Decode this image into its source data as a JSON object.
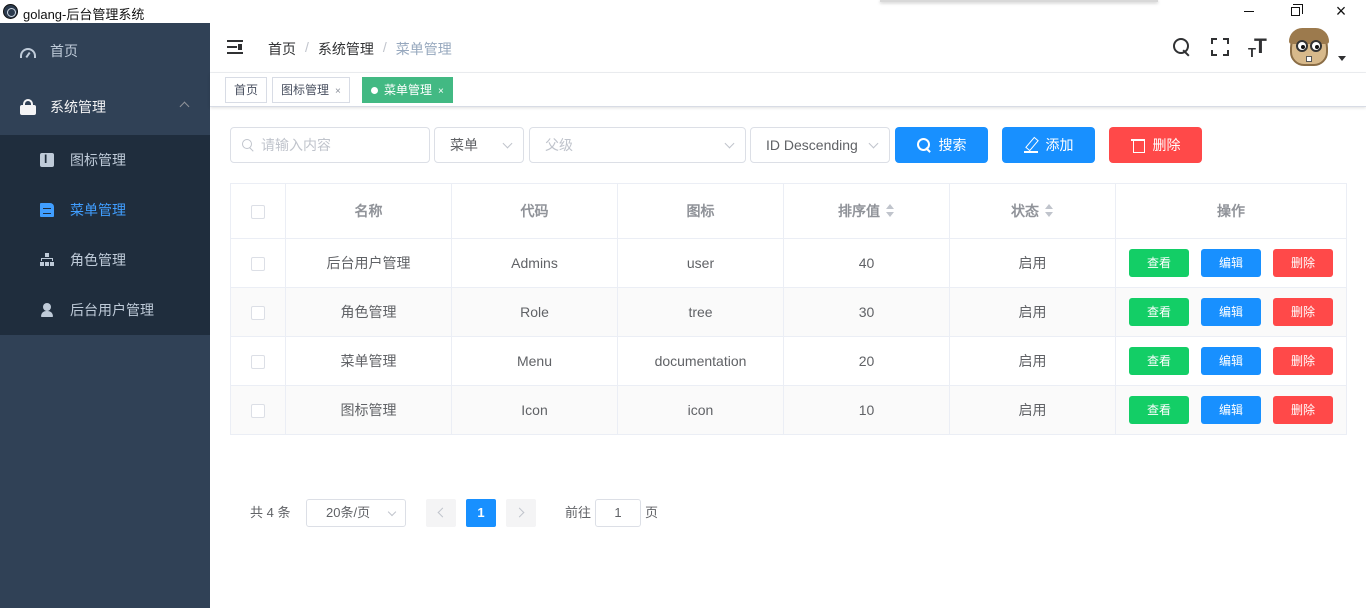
{
  "window": {
    "title": "golang-后台管理系统",
    "minimize": "minimize-icon",
    "maximize": "restore-icon",
    "close": "×"
  },
  "sidebar": {
    "home": "首页",
    "group": "系统管理",
    "items": [
      {
        "label": "图标管理",
        "icon": "icon-icon",
        "active": false
      },
      {
        "label": "菜单管理",
        "icon": "documentation-icon",
        "active": true
      },
      {
        "label": "角色管理",
        "icon": "tree-icon",
        "active": false
      },
      {
        "label": "后台用户管理",
        "icon": "user-icon",
        "active": false
      }
    ],
    "colors": {
      "background": "#304156",
      "submenu_bg": "#1f2d3d",
      "active": "#409eff"
    }
  },
  "navbar": {
    "breadcrumb": [
      "首页",
      "系统管理",
      "菜单管理"
    ],
    "separator": "/",
    "icons": [
      "search-icon",
      "fullscreen-icon",
      "font-size-icon",
      "avatar",
      "caret-down-icon"
    ]
  },
  "tags": [
    {
      "label": "首页",
      "closable": false,
      "active": false
    },
    {
      "label": "图标管理",
      "closable": true,
      "active": false
    },
    {
      "label": "菜单管理",
      "closable": true,
      "active": true
    }
  ],
  "tag_close": "×",
  "filters": {
    "search_placeholder": "请输入内容",
    "type_value": "菜单",
    "parent_placeholder": "父级",
    "sort_value": "ID Descending",
    "search_button": "搜索",
    "add_button": "添加",
    "delete_button": "删除"
  },
  "table": {
    "columns": [
      "名称",
      "代码",
      "图标",
      "排序值",
      "状态",
      "操作"
    ],
    "rows": [
      {
        "name": "后台用户管理",
        "code": "Admins",
        "icon": "user",
        "sort": "40",
        "status": "启用"
      },
      {
        "name": "角色管理",
        "code": "Role",
        "icon": "tree",
        "sort": "30",
        "status": "启用"
      },
      {
        "name": "菜单管理",
        "code": "Menu",
        "icon": "documentation",
        "sort": "20",
        "status": "启用"
      },
      {
        "name": "图标管理",
        "code": "Icon",
        "icon": "icon",
        "sort": "10",
        "status": "启用"
      }
    ],
    "actions": {
      "view": "查看",
      "edit": "编辑",
      "delete": "删除"
    }
  },
  "pagination": {
    "total": "共 4 条",
    "page_size": "20条/页",
    "current_page": "1",
    "goto_label": "前往",
    "goto_value": "1",
    "goto_unit": "页"
  },
  "colors": {
    "primary": "#1890ff",
    "success": "#13ce66",
    "danger": "#ff4949",
    "tag_active": "#42b983"
  }
}
